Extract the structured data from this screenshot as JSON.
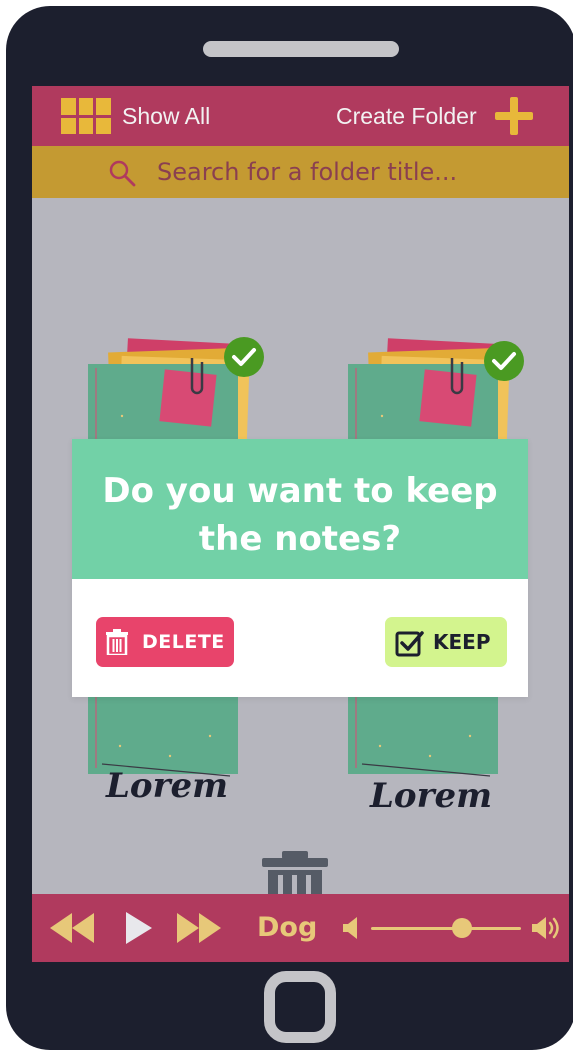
{
  "header": {
    "show_all_label": "Show All",
    "create_folder_label": "Create Folder"
  },
  "search": {
    "placeholder": "Search for a folder title..."
  },
  "notebooks": [
    {
      "cover_text": "Lorem",
      "selected": true
    },
    {
      "cover_text": "Lorem",
      "selected": true
    }
  ],
  "dialog": {
    "title": "Do you want to keep the notes?",
    "delete_label": "DELETE",
    "keep_label": "KEEP"
  },
  "player": {
    "track": "Dog",
    "volume": 0.5
  },
  "colors": {
    "header": "#b03a5e",
    "search_bar": "#c49a32",
    "accent_gold": "#e8b83a",
    "dialog_header": "#72d1a7",
    "delete": "#e8446b",
    "keep": "#d3f48e",
    "check": "#4a9a22"
  }
}
